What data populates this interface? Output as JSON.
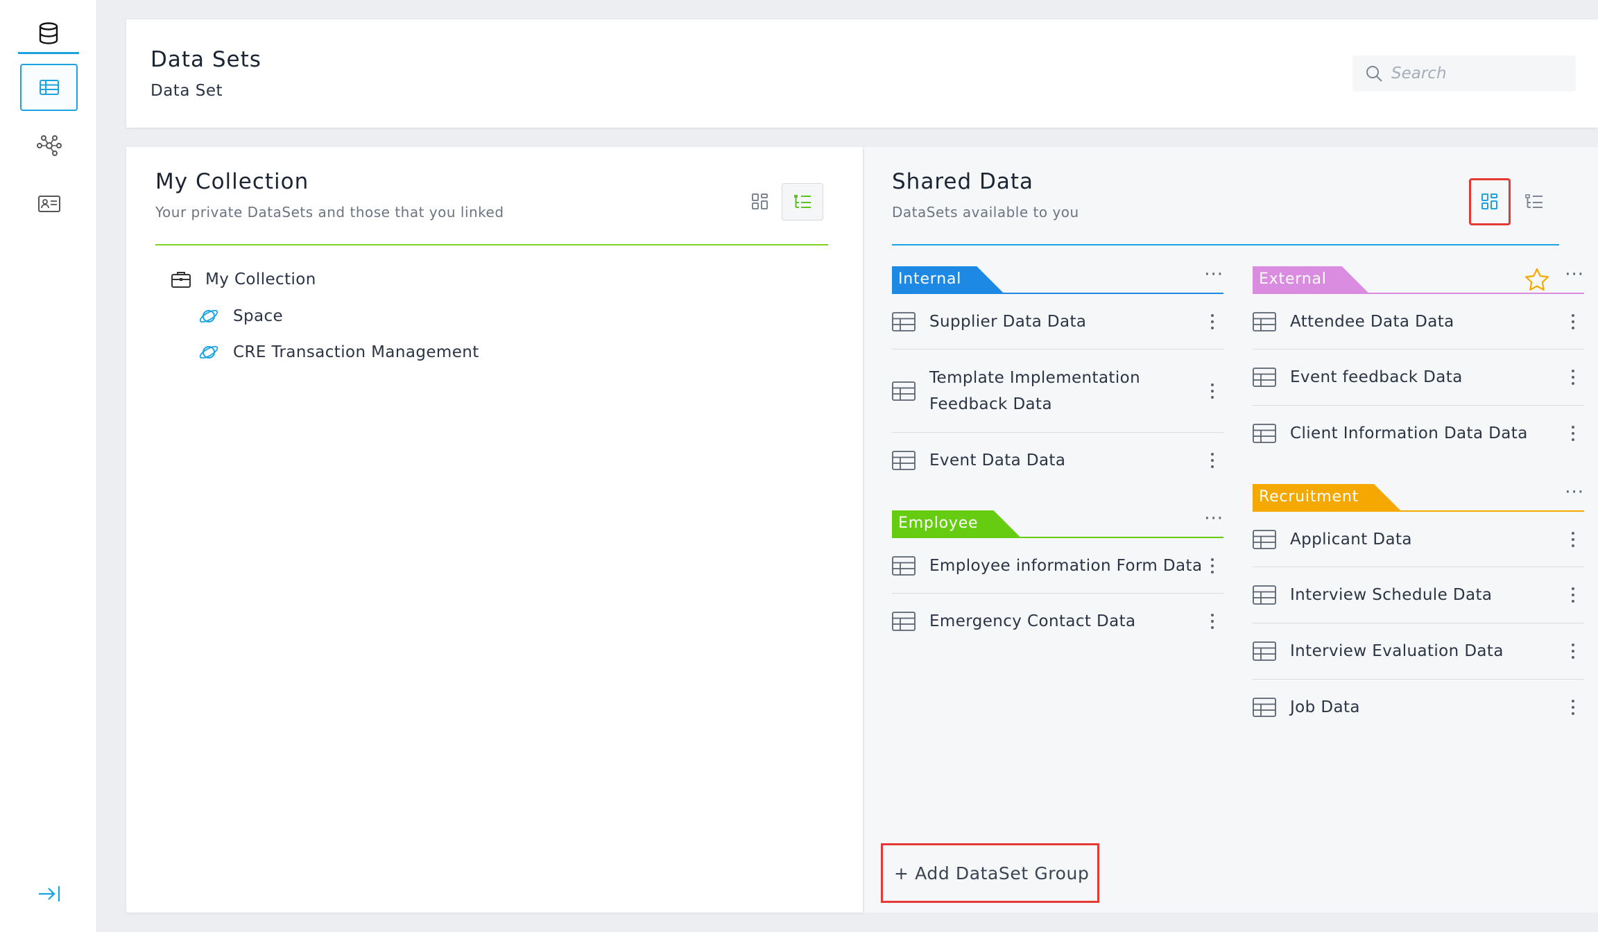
{
  "sidebar": {
    "logo_icon": "database-icon",
    "items": [
      {
        "name": "table-icon",
        "active": true
      },
      {
        "name": "network-icon",
        "active": false
      },
      {
        "name": "contact-card-icon",
        "active": false
      }
    ],
    "collapse_icon": "collapse-arrow-icon"
  },
  "header": {
    "title": "Data Sets",
    "subtitle": "Data Set",
    "search_placeholder": "Search"
  },
  "my_collection": {
    "title": "My Collection",
    "subtitle": "Your private DataSets and those that you linked",
    "accent": "#7ed321",
    "tree": {
      "root": "My Collection",
      "children": [
        "Space",
        "CRE Transaction Management"
      ]
    }
  },
  "shared": {
    "title": "Shared Data",
    "subtitle": "DataSets available to you",
    "accent": "#1aa3e0",
    "groups": {
      "internal": {
        "label": "Internal",
        "color": "#1e88e5",
        "items": [
          "Supplier Data Data",
          "Template Implementation Feedback Data",
          "Event Data Data"
        ]
      },
      "employee": {
        "label": "Employee",
        "color": "#66cc11",
        "items": [
          "Employee information Form Data",
          "Emergency Contact Data"
        ]
      },
      "external": {
        "label": "External",
        "color": "#d98ce0",
        "items": [
          "Attendee Data Data",
          "Event feedback Data",
          "Client Information Data Data"
        ]
      },
      "recruitment": {
        "label": "Recruitment",
        "color": "#f5a800",
        "items": [
          "Applicant Data",
          "Interview Schedule Data",
          "Interview Evaluation Data",
          "Job Data"
        ]
      }
    },
    "add_group_label": "+ Add DataSet Group"
  }
}
